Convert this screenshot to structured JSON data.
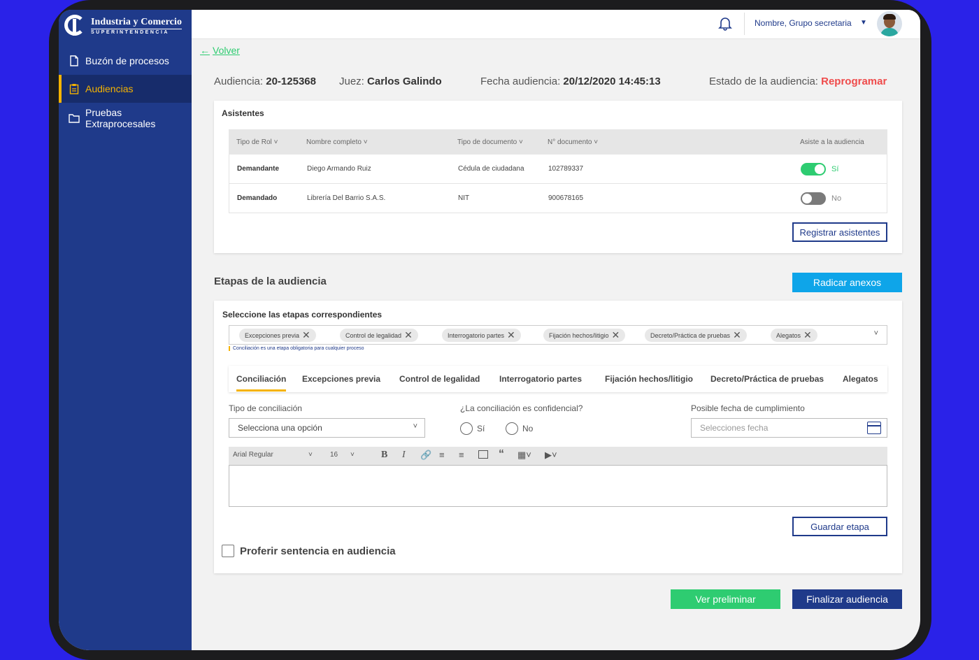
{
  "brand": {
    "line1": "Industria y Comercio",
    "line2": "SUPERINTENDENCIA"
  },
  "sidebar": {
    "items": [
      {
        "label": "Buzón de procesos",
        "icon": "document-icon"
      },
      {
        "label": "Audiencias",
        "icon": "clipboard-icon"
      },
      {
        "label": "Pruebas Extraprocesales",
        "icon": "folder-icon"
      }
    ]
  },
  "topbar": {
    "user": "Nombre, Grupo secretaria"
  },
  "back": "Volver",
  "header": {
    "audiencia_label": "Audiencia:",
    "audiencia_value": "20-125368",
    "juez_label": "Juez:",
    "juez_value": "Carlos Galindo",
    "fecha_label": "Fecha audiencia:",
    "fecha_value": "20/12/2020 14:45:13",
    "estado_label": "Estado de la audiencia:",
    "estado_value": "Reprogramar"
  },
  "asistentes": {
    "title": "Asistentes",
    "columns": [
      "Tipo de Rol",
      "Nombre completo",
      "Tipo de documento",
      "N° documento",
      "Asiste a la audiencia"
    ],
    "rows": [
      {
        "rol": "Demandante",
        "nombre": "Diego Armando Ruiz",
        "tipo_doc": "Cédula de ciudadana",
        "numero": "102789337",
        "asiste": "Sí"
      },
      {
        "rol": "Demandado",
        "nombre": "Librería Del Barrio S.A.S.",
        "tipo_doc": "NIT",
        "numero": "900678165",
        "asiste": "No"
      }
    ],
    "register_button": "Registrar asistentes"
  },
  "etapas": {
    "title": "Etapas de la audiencia",
    "radicar_button": "Radicar anexos",
    "select_label": "Seleccione las etapas correspondientes",
    "chips": [
      "Excepciones previa",
      "Control de legalidad",
      "Interrogatorio partes",
      "Fijación hechos/litigio",
      "Decreto/Práctica de pruebas",
      "Alegatos"
    ],
    "note": "Conciliación es una etapa obligatoria para cualquier proceso",
    "tabs": [
      "Conciliación",
      "Excepciones previa",
      "Control de legalidad",
      "Interrogatorio partes",
      "Fijación hechos/litigio",
      "Decreto/Práctica de pruebas",
      "Alegatos"
    ],
    "tipo_label": "Tipo de conciliación",
    "tipo_placeholder": "Selecciona una opción",
    "confidencial_label": "¿La conciliación es confidencial?",
    "radio_si": "Sí",
    "radio_no": "No",
    "fecha_label": "Posible fecha de cumplimiento",
    "fecha_placeholder": "Selecciones fecha",
    "editor": {
      "font": "Arial Regular",
      "size": "16"
    },
    "guardar_button": "Guardar etapa",
    "proferir_label": "Proferir sentencia en audiencia"
  },
  "footer": {
    "preliminar": "Ver preliminar",
    "finalizar": "Finalizar audiencia"
  },
  "colors": {
    "navy": "#1f3a8a",
    "accent": "#f5b301",
    "green": "#2ecc71",
    "cyan": "#0ea5e9",
    "red": "#ef4b4b"
  }
}
